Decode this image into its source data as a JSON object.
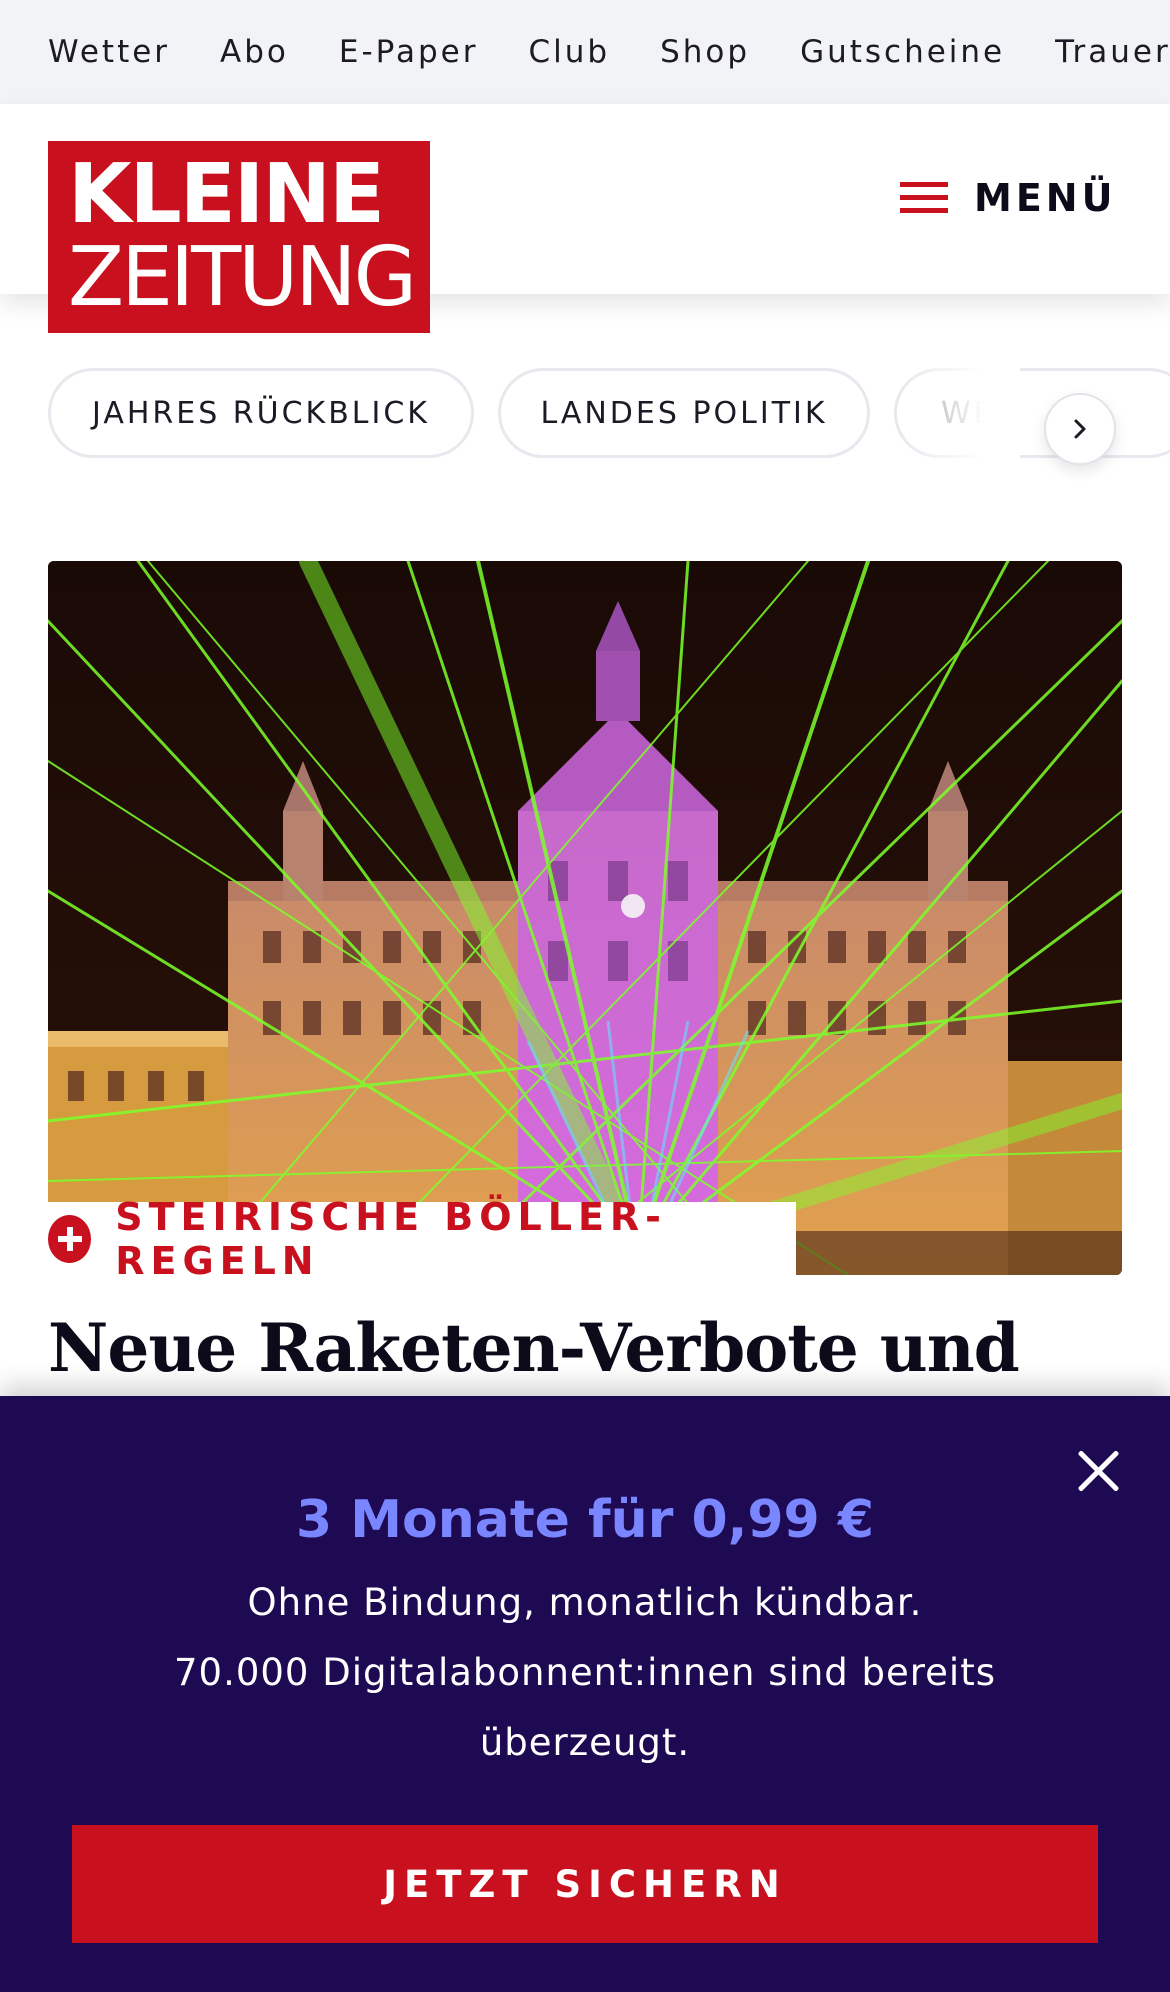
{
  "topnav": {
    "items": [
      "Wetter",
      "Abo",
      "E-Paper",
      "Club",
      "Shop",
      "Gutscheine",
      "Trauerportal"
    ]
  },
  "header": {
    "logo_line1": "KLEINE",
    "logo_line2": "ZEITUNG",
    "menu_label": "MENÜ"
  },
  "topics": {
    "chips": [
      "JAHRES RÜCKBLICK",
      "LANDES POLITIK",
      "WE"
    ]
  },
  "article": {
    "kicker": "STEIRISCHE BÖLLER-REGELN",
    "headline": "Neue Raketen-Verbote und"
  },
  "paywall": {
    "offer": "3 Monate für 0,99 €",
    "line1": "Ohne Bindung, monatlich kündbar.",
    "line2": "70.000 Digitalabonnent:innen sind bereits überzeugt.",
    "cta_label": "JETZT SICHERN"
  },
  "colors": {
    "brand_red": "#c8101e",
    "overlay_bg": "#1e0a52",
    "offer_blue": "#7a86ff",
    "topnav_bg": "#f2f3f6"
  }
}
